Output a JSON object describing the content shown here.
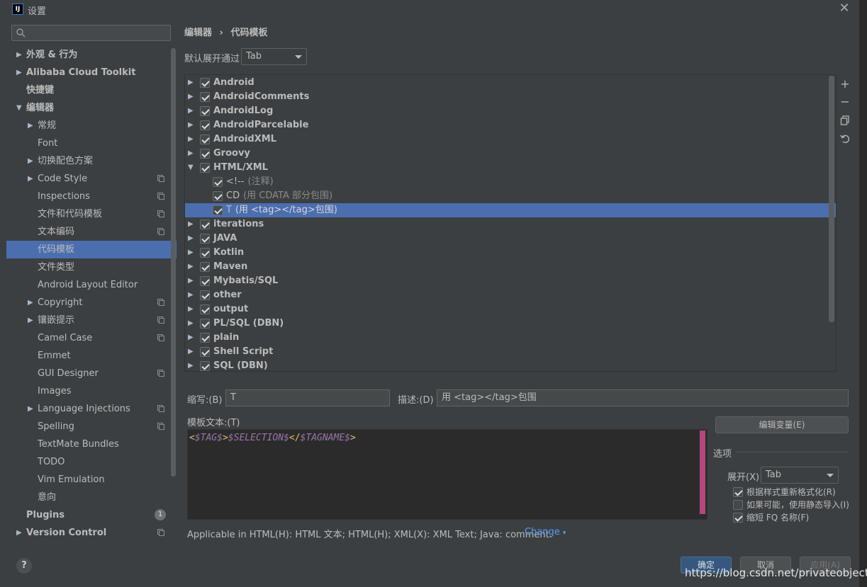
{
  "window": {
    "title": "设置",
    "app_icon": "IJ"
  },
  "search": {
    "placeholder": ""
  },
  "sidebar": {
    "items": [
      {
        "label": "外观 & 行为",
        "bold": true,
        "arrow": "right"
      },
      {
        "label": "Alibaba Cloud Toolkit",
        "bold": true,
        "arrow": "right"
      },
      {
        "label": "快捷键",
        "bold": true
      },
      {
        "label": "编辑器",
        "bold": true,
        "arrow": "down"
      },
      {
        "label": "常规",
        "arrow": "right",
        "indent": true
      },
      {
        "label": "Font",
        "indent": true
      },
      {
        "label": "切换配色方案",
        "arrow": "right",
        "indent": true
      },
      {
        "label": "Code Style",
        "arrow": "right",
        "indent": true,
        "cfg": true
      },
      {
        "label": "Inspections",
        "indent": true,
        "cfg": true
      },
      {
        "label": "文件和代码模板",
        "indent": true,
        "cfg": true
      },
      {
        "label": "文本编码",
        "indent": true,
        "cfg": true
      },
      {
        "label": "代码模板",
        "indent": true,
        "selected": true
      },
      {
        "label": "文件类型",
        "indent": true
      },
      {
        "label": "Android Layout Editor",
        "indent": true
      },
      {
        "label": "Copyright",
        "arrow": "right",
        "indent": true,
        "cfg": true
      },
      {
        "label": "镶嵌提示",
        "arrow": "right",
        "indent": true,
        "cfg": true
      },
      {
        "label": "Camel Case",
        "indent": true,
        "cfg": true
      },
      {
        "label": "Emmet",
        "indent": true
      },
      {
        "label": "GUI Designer",
        "indent": true,
        "cfg": true
      },
      {
        "label": "Images",
        "indent": true
      },
      {
        "label": "Language Injections",
        "arrow": "right",
        "indent": true,
        "cfg": true
      },
      {
        "label": "Spelling",
        "indent": true,
        "cfg": true
      },
      {
        "label": "TextMate Bundles",
        "indent": true
      },
      {
        "label": "TODO",
        "indent": true
      },
      {
        "label": "Vim Emulation",
        "indent": true
      },
      {
        "label": "意向",
        "indent": true
      },
      {
        "label": "Plugins",
        "bold": true,
        "badge": "1"
      },
      {
        "label": "Version Control",
        "bold": true,
        "arrow": "right",
        "cfg": true
      }
    ]
  },
  "breadcrumb": {
    "parent": "编辑器",
    "separator": "›",
    "current": "代码模板"
  },
  "expand_with": {
    "label": "默认展开通过",
    "value": "Tab"
  },
  "tree": [
    {
      "label": "Android",
      "level": 0,
      "arrow": "right",
      "bold": true
    },
    {
      "label": "AndroidComments",
      "level": 0,
      "arrow": "right",
      "bold": true
    },
    {
      "label": "AndroidLog",
      "level": 0,
      "arrow": "right",
      "bold": true
    },
    {
      "label": "AndroidParcelable",
      "level": 0,
      "arrow": "right",
      "bold": true
    },
    {
      "label": "AndroidXML",
      "level": 0,
      "arrow": "right",
      "bold": true
    },
    {
      "label": "Groovy",
      "level": 0,
      "arrow": "right",
      "bold": true
    },
    {
      "label": "HTML/XML",
      "level": 0,
      "arrow": "down",
      "bold": true
    },
    {
      "label": "<!--",
      "desc": "(注释)",
      "level": 1
    },
    {
      "label": "CD",
      "desc": "(用 CDATA 部分包围)",
      "level": 1
    },
    {
      "label": "T",
      "desc": "(用 <tag></tag>包围)",
      "level": 1,
      "selected": true
    },
    {
      "label": "iterations",
      "level": 0,
      "arrow": "right",
      "bold": true
    },
    {
      "label": "JAVA",
      "level": 0,
      "arrow": "right",
      "bold": true
    },
    {
      "label": "Kotlin",
      "level": 0,
      "arrow": "right",
      "bold": true
    },
    {
      "label": "Maven",
      "level": 0,
      "arrow": "right",
      "bold": true
    },
    {
      "label": "Mybatis/SQL",
      "level": 0,
      "arrow": "right",
      "bold": true
    },
    {
      "label": "other",
      "level": 0,
      "arrow": "right",
      "bold": true
    },
    {
      "label": "output",
      "level": 0,
      "arrow": "right",
      "bold": true
    },
    {
      "label": "PL/SQL (DBN)",
      "level": 0,
      "arrow": "right",
      "bold": true
    },
    {
      "label": "plain",
      "level": 0,
      "arrow": "right",
      "bold": true
    },
    {
      "label": "Shell Script",
      "level": 0,
      "arrow": "right",
      "bold": true
    },
    {
      "label": "SQL (DBN)",
      "level": 0,
      "arrow": "right",
      "bold": true
    }
  ],
  "tree_tools": [
    "+",
    "−",
    "copy-icon",
    "undo-icon"
  ],
  "abbrev": {
    "label": "缩写:(B)",
    "value": "T"
  },
  "description": {
    "label": "描述:(D)",
    "value": "用 <tag></tag>包围"
  },
  "template_text": {
    "label": "模板文本:(T)",
    "parts": {
      "p1": "<",
      "v1": "$TAG$",
      "p2": ">",
      "v2": "$SELECTION$",
      "p3": "</",
      "v3": "$TAGNAME$",
      "p4": ">"
    }
  },
  "edit_vars_button": "编辑变量(E)",
  "options": {
    "label": "选项",
    "expand_label": "展开(X)",
    "expand_value": "Tab",
    "checks": [
      {
        "label": "根据样式重新格式化(R)",
        "checked": true
      },
      {
        "label": "如果可能，使用静态导入(I)",
        "checked": false
      },
      {
        "label": "缩短 FQ 名称(F)",
        "checked": true
      }
    ]
  },
  "applicable": {
    "text": "Applicable in HTML(H): HTML 文本; HTML(H); XML(X): XML Text; Java: comment.",
    "change": "Change"
  },
  "buttons": {
    "ok": "确定",
    "cancel": "取消",
    "apply": "应用(A)"
  },
  "help": "?",
  "watermark": "https://blog.csdn.net/privateobject",
  "colors": {
    "selection": "#4b6eaf",
    "panel": "#3c3f41",
    "editor_bg": "#2b2b2b",
    "link": "#589df6"
  }
}
